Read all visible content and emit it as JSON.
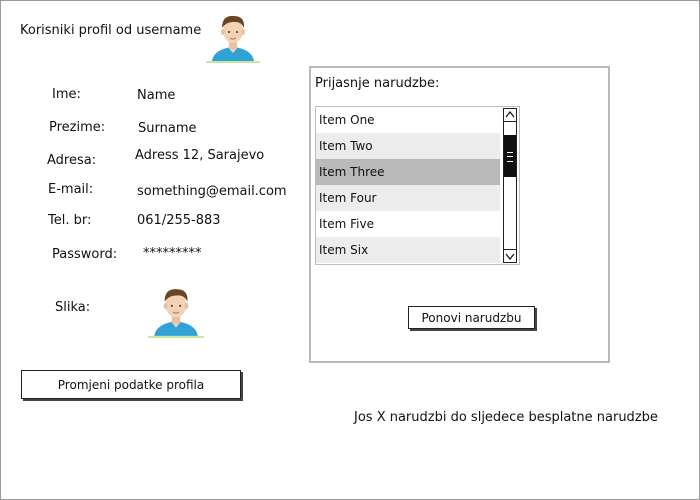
{
  "header": {
    "title": "Korisniki profil od username"
  },
  "profile": {
    "fields": [
      {
        "label": "Ime:",
        "value": "Name"
      },
      {
        "label": "Prezime:",
        "value": "Surname"
      },
      {
        "label": "Adresa:",
        "value": "Adress 12, Sarajevo"
      },
      {
        "label": "E-mail:",
        "value": "something@email.com"
      },
      {
        "label": "Tel. br:",
        "value": "061/255-883"
      },
      {
        "label": "Password:",
        "value": "*********"
      }
    ],
    "image_label": "Slika:",
    "edit_button_label": "Promjeni podatke profila"
  },
  "orders": {
    "title": "Prijasnje narudzbe:",
    "items": [
      "Item One",
      "Item Two",
      "Item Three",
      "Item Four",
      "Item Five",
      "Item Six"
    ],
    "selected_item": "Item Three",
    "reorder_button_label": "Ponovi narudzbu"
  },
  "footer": {
    "note": "Jos X narudzbi do sljedece besplatne narudzbe"
  },
  "colors": {
    "border": "#b9b9b9",
    "selected_row": "#b9b9b9",
    "alt_row": "#ececec",
    "avatar_shirt": "#2fa3d6",
    "avatar_hair": "#6b4424",
    "avatar_skin": "#f4d2b6"
  },
  "icons": {
    "header_avatar": "user-avatar-icon",
    "profile_picture": "user-avatar-icon",
    "scroll_up": "chevron-up-icon",
    "scroll_down": "chevron-down-icon"
  }
}
